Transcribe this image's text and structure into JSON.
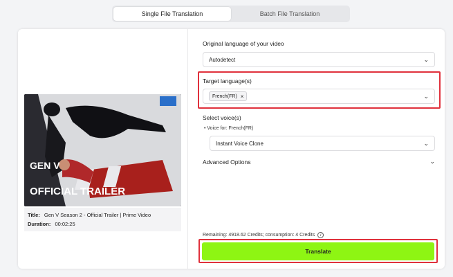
{
  "tabs": [
    {
      "label": "Single File Translation",
      "active": true
    },
    {
      "label": "Batch File Translation",
      "active": false
    }
  ],
  "video": {
    "thumbnail_text_top": "GEN V",
    "thumbnail_text": "OFFICIAL TRAILER",
    "title_label": "Title:",
    "title_value": "Gen V Season 2 - Official Trailer | Prime Video",
    "duration_label": "Duration:",
    "duration_value": "00:02:25"
  },
  "form": {
    "original_language_label": "Original language of your video",
    "original_language_value": "Autodetect",
    "target_language_label": "Target language(s)",
    "target_language_chip": "French(FR)",
    "chip_remove": "×",
    "select_voice_label": "Select voice(s)",
    "voice_for_label": "• Voice for: French(FR)",
    "voice_value": "Instant Voice Clone",
    "advanced_label": "Advanced Options"
  },
  "footer": {
    "credits_text": "Remaining: 4918.62 Credits; consumption: 4 Credits",
    "info_glyph": "i",
    "translate_label": "Translate"
  },
  "colors": {
    "highlight": "#e0313c",
    "translate_button": "#8ef513"
  }
}
